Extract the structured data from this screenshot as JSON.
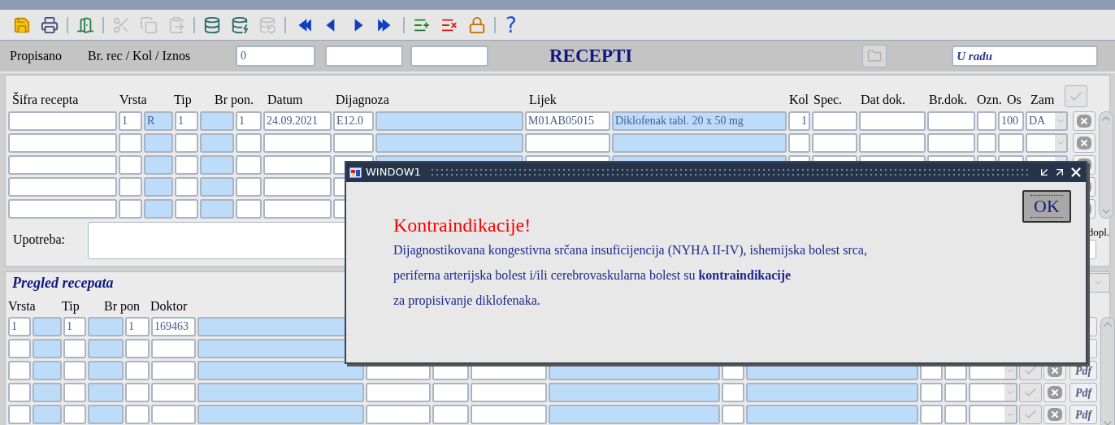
{
  "toolbar": [
    {
      "kind": "save",
      "disabled": false
    },
    {
      "kind": "print",
      "disabled": false
    },
    {
      "kind": "separator"
    },
    {
      "kind": "exit",
      "disabled": false
    },
    {
      "kind": "separator"
    },
    {
      "kind": "cut",
      "disabled": true
    },
    {
      "kind": "copy",
      "disabled": true
    },
    {
      "kind": "paste",
      "disabled": true
    },
    {
      "kind": "separator"
    },
    {
      "kind": "query",
      "disabled": false
    },
    {
      "kind": "execute",
      "disabled": false
    },
    {
      "kind": "cancel_query",
      "disabled": true
    },
    {
      "kind": "separator"
    },
    {
      "kind": "first",
      "disabled": false
    },
    {
      "kind": "previous",
      "disabled": false
    },
    {
      "kind": "next",
      "disabled": false
    },
    {
      "kind": "last",
      "disabled": false
    },
    {
      "kind": "separator"
    },
    {
      "kind": "insert",
      "disabled": false
    },
    {
      "kind": "delete",
      "disabled": false
    },
    {
      "kind": "lock",
      "disabled": false
    },
    {
      "kind": "separator"
    },
    {
      "kind": "help",
      "disabled": false,
      "glyph": "?"
    }
  ],
  "header": {
    "propisano_label": "Propisano",
    "count_label": "Br. rec / Kol / Iznos",
    "count_value": "0",
    "title": "RECEPTI",
    "status": "U radu"
  },
  "prescriptions": {
    "columns": [
      "Šifra recepta",
      "Vrsta",
      "Tip",
      "Br pon.",
      "Datum",
      "Dijagnoza",
      "Lijek",
      "Kol",
      "Spec.",
      "Dat dok.",
      "Br.dok.",
      "Ozn.",
      "Os",
      "Zam"
    ],
    "rows": [
      {
        "vrsta": "1",
        "vrsta_oznaka": "R",
        "tip": "1",
        "br_pon": "1",
        "datum": "24.09.2021",
        "dijagnoza": "E12.0",
        "lijek": "M01AB05015",
        "lijek_naziv": "Diklofenak tabl. 20 x 50 mg",
        "kol": "1",
        "os": "100",
        "zam": "DA"
      },
      {},
      {},
      {},
      {}
    ],
    "upotreba_label": "Upotreba:",
    "dopl_label": "dopl."
  },
  "review": {
    "title": "Pregled recepata",
    "columns": [
      "Vrsta",
      "Tip",
      "Br pon",
      "Doktor"
    ],
    "rows": [
      {
        "vrsta": "1",
        "tip": "1",
        "br_pon": "1",
        "doktor": "169463"
      },
      {},
      {
        "pdf": "Pdf"
      },
      {
        "pdf": "Pdf"
      },
      {
        "pdf": "Pdf"
      }
    ]
  },
  "dialog": {
    "title": "WINDOW1",
    "heading": "Kontraindikacije!",
    "lines": [
      "Dijagnostikovana kongestivna srčana insuficijencija (NYHA II-IV), ishemijska bolest srca,",
      "periferna arterijska bolest i/ili cerebrovaskularna bolest su **kontraindikacije**",
      "za propisivanje diklofenaka."
    ],
    "ok": "OK"
  }
}
